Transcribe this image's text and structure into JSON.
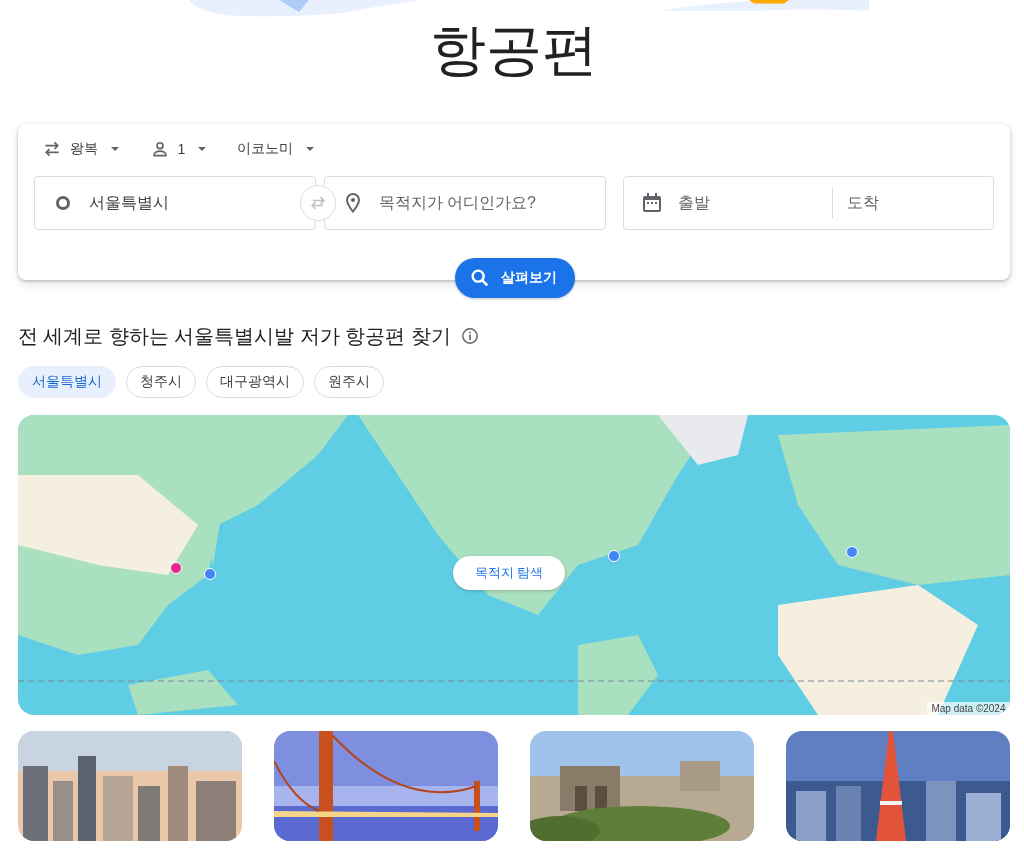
{
  "title": "항공편",
  "options": [
    {
      "kind": "trip",
      "label": "왕복"
    },
    {
      "kind": "passengers",
      "label": "1"
    },
    {
      "kind": "cabin",
      "label": "이코노미"
    }
  ],
  "origin": {
    "value": "서울특별시"
  },
  "destination": {
    "placeholder": "목적지가 어디인가요?"
  },
  "dates": {
    "departure_placeholder": "출발",
    "return_placeholder": "도착"
  },
  "search_button": "살펴보기",
  "section_heading": "전 세계로 향하는 서울특별시발 저가 항공편 찾기",
  "cities": [
    {
      "label": "서울특별시",
      "selected": true
    },
    {
      "label": "청주시",
      "selected": false
    },
    {
      "label": "대구광역시",
      "selected": false
    },
    {
      "label": "원주시",
      "selected": false
    }
  ],
  "map": {
    "explore_button": "목적지 탐색",
    "attribution": "Map data ©2024",
    "markers": [
      {
        "color": "#e52592"
      },
      {
        "color": "#4285f4"
      },
      {
        "color": "#4285f4"
      },
      {
        "color": "#4285f4"
      }
    ]
  },
  "destination_cards": [
    {
      "kind": "city"
    },
    {
      "kind": "bridge"
    },
    {
      "kind": "ruins"
    },
    {
      "kind": "tower"
    }
  ]
}
